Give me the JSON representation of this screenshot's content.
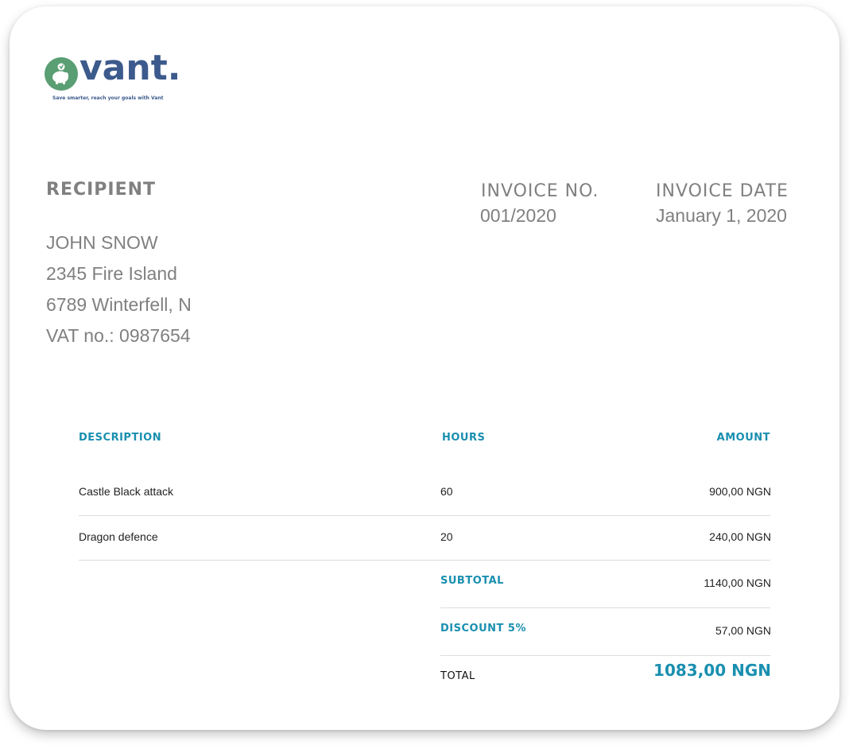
{
  "brand": {
    "name": "vant.",
    "tagline": "Save smarter, reach your goals with Vant",
    "colors": {
      "green": "#5a9e73",
      "navy": "#3c5a8c",
      "accent": "#1a8fb0"
    }
  },
  "recipient": {
    "heading": "RECIPIENT",
    "name": "JOHN SNOW",
    "address1": "2345 Fire Island",
    "address2": "6789 Winterfell, N",
    "vat": "VAT no.: 0987654"
  },
  "invoice": {
    "number_label": "INVOICE NO.",
    "number": "001/2020",
    "date_label": "INVOICE DATE",
    "date": "January 1, 2020"
  },
  "table": {
    "headers": {
      "description": "DESCRIPTION",
      "hours": "HOURS",
      "amount": "AMOUNT"
    },
    "rows": [
      {
        "description": "Castle Black attack",
        "hours": "60",
        "amount": "900,00 NGN"
      },
      {
        "description": "Dragon defence",
        "hours": "20",
        "amount": "240,00 NGN"
      }
    ]
  },
  "summary": {
    "subtotal_label": "SUBTOTAL",
    "subtotal": "1140,00 NGN",
    "discount_label": "DISCOUNT 5%",
    "discount": "57,00 NGN",
    "total_label": "TOTAL",
    "total": "1083,00 NGN"
  }
}
